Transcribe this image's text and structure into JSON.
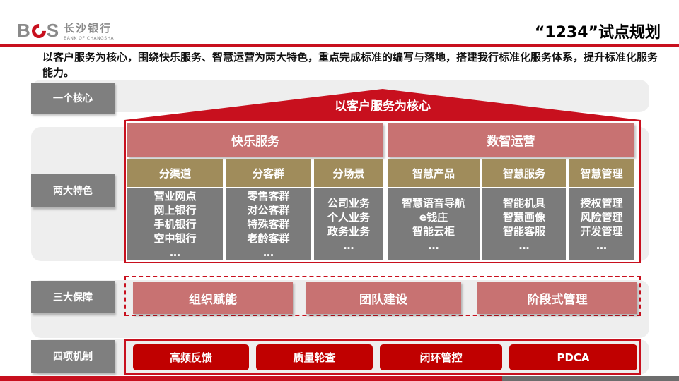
{
  "header": {
    "logo_mark": "BCS",
    "logo_cn": "长沙银行",
    "logo_en": "BANK OF CHANGSHA",
    "title": "“1234”试点规划"
  },
  "intro": "以客户服务为核心，围绕快乐服务、智慧运营为两大特色，重点完成标准的编写与落地，搭建我行标准化服务体系，提升标准化服务能力。",
  "row_labels": {
    "core": "一个核心",
    "features": "两大特色",
    "guarantees": "三大保障",
    "mechanisms": "四项机制"
  },
  "core": "以客户服务为核心",
  "categories": [
    {
      "name": "快乐服务",
      "groups": [
        {
          "name": "分渠道",
          "items": [
            "营业网点",
            "网上银行",
            "手机银行",
            "空中银行",
            "…"
          ]
        },
        {
          "name": "分客群",
          "items": [
            "零售客群",
            "对公客群",
            "特殊客群",
            "老龄客群",
            "…"
          ]
        },
        {
          "name": "分场景",
          "items": [
            "公司业务",
            "个人业务",
            "政务业务",
            "…"
          ]
        }
      ]
    },
    {
      "name": "数智运营",
      "groups": [
        {
          "name": "智慧产品",
          "items": [
            "智慧语音导航",
            "e钱庄",
            "智能云柜",
            "…"
          ]
        },
        {
          "name": "智慧服务",
          "items": [
            "智能机具",
            "智慧画像",
            "智能客服",
            "…"
          ]
        },
        {
          "name": "智慧管理",
          "items": [
            "授权管理",
            "风险管理",
            "开发管理",
            "…"
          ]
        }
      ]
    }
  ],
  "guarantees": [
    "组织赋能",
    "团队建设",
    "阶段式管理"
  ],
  "mechanisms": [
    "高频反馈",
    "质量轮查",
    "闭环管控",
    "PDCA"
  ],
  "colors": {
    "brand_red": "#c8101e",
    "category_fill": "#c87272",
    "subcategory_fill": "#a08c5b",
    "item_fill": "#7b7b7b",
    "label_fill": "#7f7f7f"
  }
}
